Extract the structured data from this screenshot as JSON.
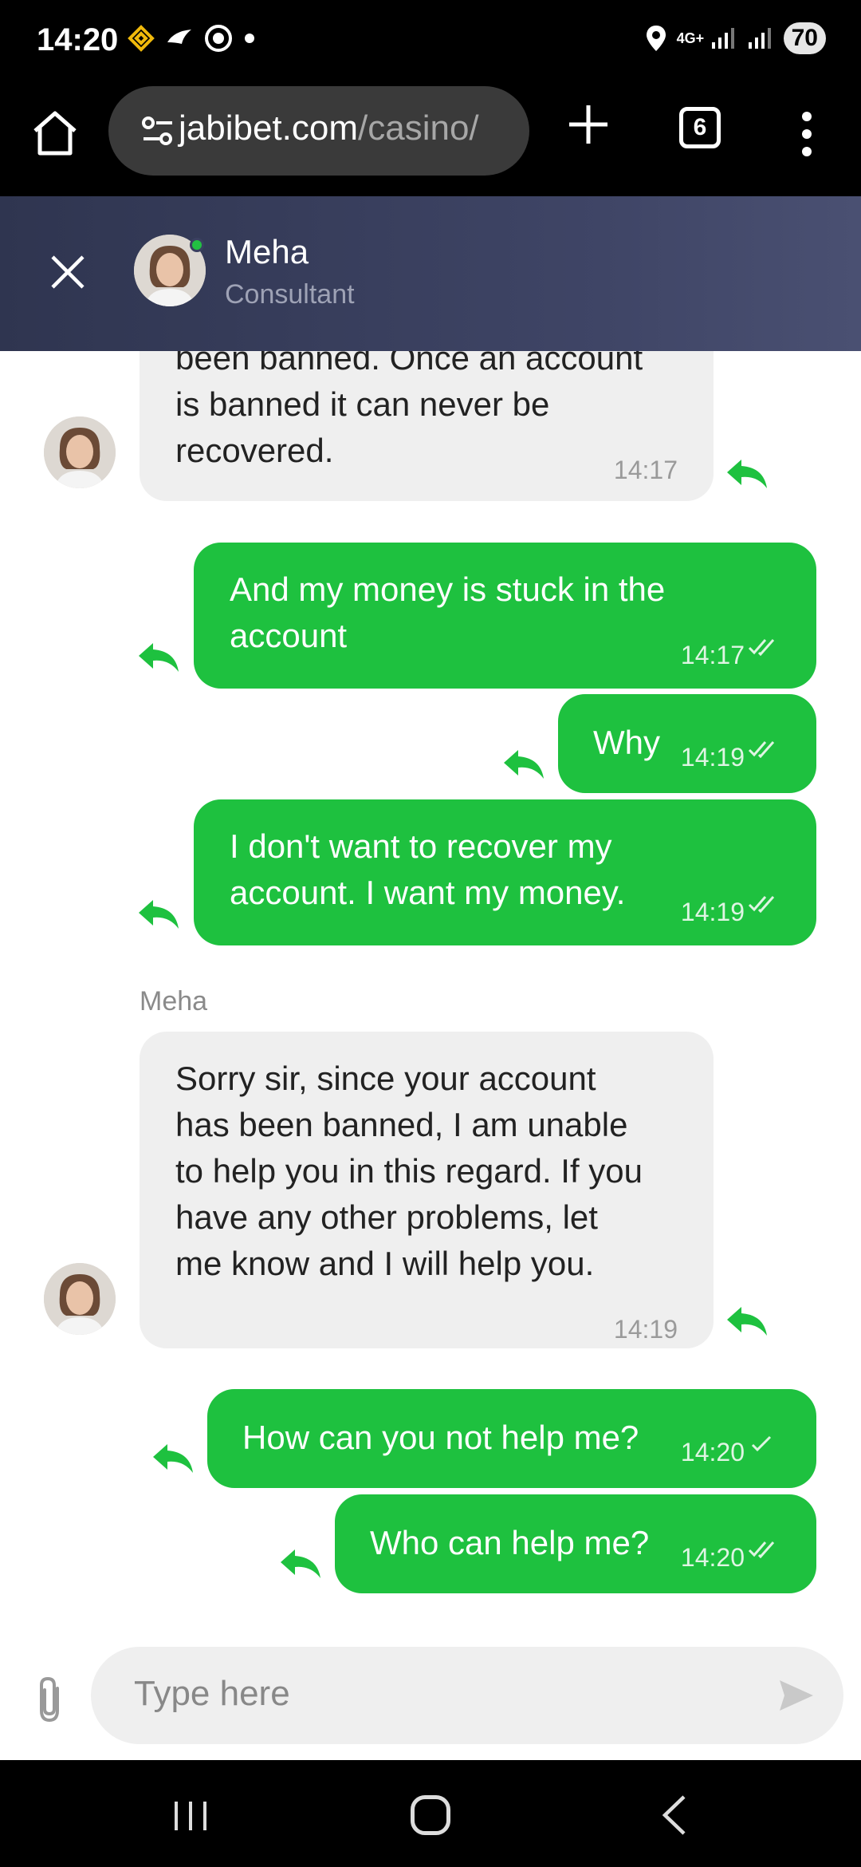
{
  "status_bar": {
    "time": "14:20",
    "battery": "70",
    "network": "4G+"
  },
  "browser": {
    "url_host": "jabibet.com",
    "url_path": "/casino/",
    "tab_count": "6"
  },
  "chat_header": {
    "agent_name": "Meha",
    "agent_role": "Consultant"
  },
  "messages": [
    {
      "direction": "in",
      "text": "been banned. Once an account\nis banned it can never be\nrecovered.",
      "time": "14:17"
    },
    {
      "direction": "out",
      "text": "And my money is stuck in the\naccount",
      "time": "14:17",
      "status": "read"
    },
    {
      "direction": "out",
      "text": "Why",
      "time": "14:19",
      "status": "read"
    },
    {
      "direction": "out",
      "text": "I don't want to recover my\naccount. I want my money.",
      "time": "14:19",
      "status": "read"
    },
    {
      "direction": "in",
      "sender": "Meha",
      "text": "Sorry sir, since your account\nhas been banned, I am unable\nto help you in this regard. If you\nhave any other problems, let\nme know and I will help you.",
      "time": "14:19"
    },
    {
      "direction": "out",
      "text": "How can you not help me?",
      "time": "14:20",
      "status": "sent"
    },
    {
      "direction": "out",
      "text": "Who can help me?",
      "time": "14:20",
      "status": "read"
    }
  ],
  "composer": {
    "placeholder": "Type here",
    "value": ""
  },
  "colors": {
    "accent_green": "#1ec13f",
    "header_bg": "#3a4060",
    "online_dot": "#22c042"
  }
}
